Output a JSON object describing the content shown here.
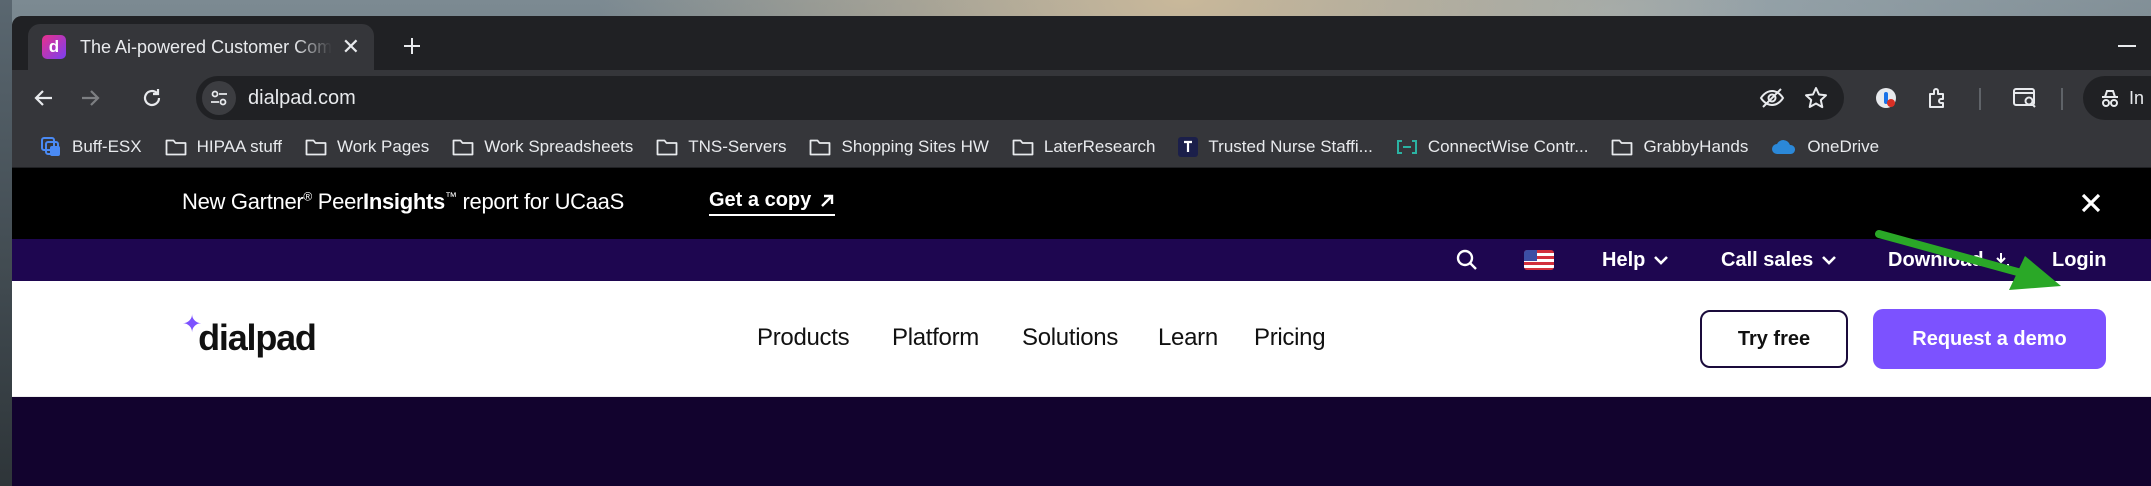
{
  "browser": {
    "tab": {
      "title": "The Ai-powered Customer Communications Platform | Dialpad",
      "favicon_letter": "d",
      "favicon_colors": [
        "#e8308a",
        "#7a3ff2"
      ]
    },
    "address": {
      "url": "dialpad.com"
    },
    "profile_label": "In",
    "bookmarks": [
      {
        "label": "Buff-ESX",
        "icon": "stack-icon"
      },
      {
        "label": "HIPAA stuff",
        "icon": "folder-icon"
      },
      {
        "label": "Work Pages",
        "icon": "folder-icon"
      },
      {
        "label": "Work Spreadsheets",
        "icon": "folder-icon"
      },
      {
        "label": "TNS-Servers",
        "icon": "folder-icon"
      },
      {
        "label": "Shopping Sites HW",
        "icon": "folder-icon"
      },
      {
        "label": "LaterResearch",
        "icon": "folder-icon"
      },
      {
        "label": "Trusted Nurse Staffi...",
        "icon": "tns-logo-icon"
      },
      {
        "label": "ConnectWise Contr...",
        "icon": "connectwise-icon"
      },
      {
        "label": "GrabbyHands",
        "icon": "folder-icon"
      },
      {
        "label": "OneDrive",
        "icon": "cloud-icon"
      }
    ]
  },
  "page": {
    "promo": {
      "text_pre": "New Gartner",
      "text_mid": " Peer",
      "text_brand": "Insights",
      "text_post": " report for UCaaS",
      "reg": "®",
      "tm": "™",
      "cta": "Get a copy"
    },
    "utility_nav": {
      "help": "Help",
      "call_sales": "Call sales",
      "download": "Download",
      "login": "Login"
    },
    "logo_text": "dialpad",
    "main_nav": [
      "Products",
      "Platform",
      "Solutions",
      "Learn",
      "Pricing"
    ],
    "buttons": {
      "try_free": "Try free",
      "request_demo": "Request a demo"
    },
    "colors": {
      "brand_purple": "#7c52ff",
      "utility_bar": "#1e0650",
      "hero_bg": "#12032e",
      "annotation_arrow": "#2aa827"
    }
  }
}
